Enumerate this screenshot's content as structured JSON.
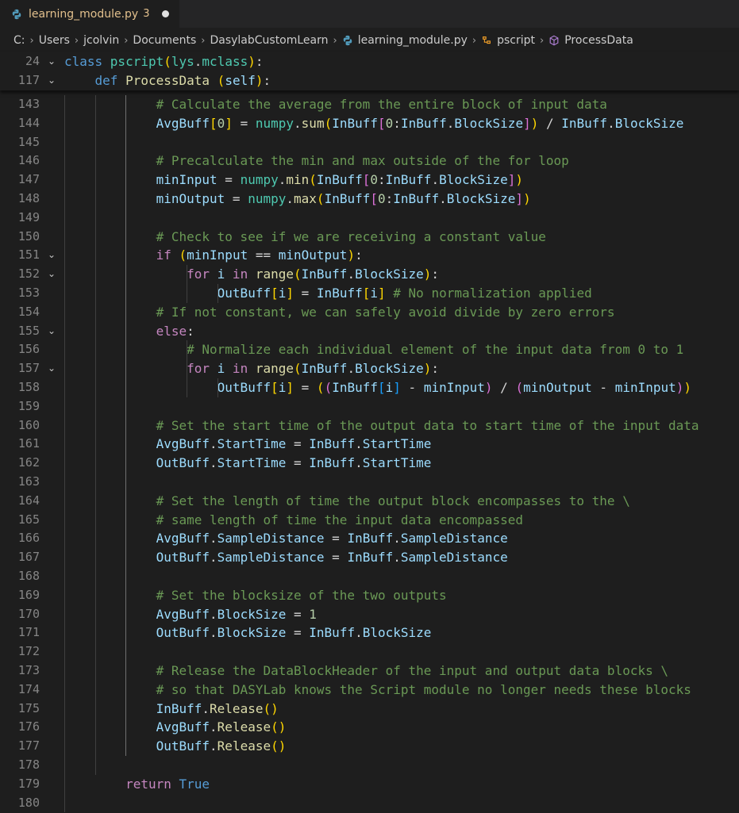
{
  "tab": {
    "filename": "learning_module.py",
    "problem_count": "3"
  },
  "breadcrumb": {
    "items": [
      "C:",
      "Users",
      "jcolvin",
      "Documents",
      "DasylabCustomLearn",
      "learning_module.py",
      "pscript",
      "ProcessData"
    ]
  },
  "sticky_scroll": [
    {
      "line": "24",
      "tokens": [
        [
          "kw",
          "class "
        ],
        [
          "cls",
          "pscript"
        ],
        [
          "b1",
          "("
        ],
        [
          "cls",
          "lys"
        ],
        [
          "op",
          "."
        ],
        [
          "cls",
          "mclass"
        ],
        [
          "b1",
          ")"
        ],
        [
          "op",
          ":"
        ]
      ]
    },
    {
      "line": "117",
      "tokens": [
        [
          "op",
          "    "
        ],
        [
          "kw",
          "def "
        ],
        [
          "fn",
          "ProcessData"
        ],
        [
          "op",
          " "
        ],
        [
          "b1",
          "("
        ],
        [
          "slf",
          "self"
        ],
        [
          "b1",
          ")"
        ],
        [
          "op",
          ":"
        ]
      ]
    }
  ],
  "code_lines": [
    {
      "line": "143",
      "tokens": [
        [
          "op",
          "            "
        ],
        [
          "cmt",
          "# Calculate the average from the entire block of input data"
        ]
      ]
    },
    {
      "line": "144",
      "tokens": [
        [
          "op",
          "            "
        ],
        [
          "var",
          "AvgBuff"
        ],
        [
          "b1",
          "["
        ],
        [
          "num",
          "0"
        ],
        [
          "b1",
          "]"
        ],
        [
          "op",
          " = "
        ],
        [
          "cls",
          "numpy"
        ],
        [
          "op",
          "."
        ],
        [
          "fn",
          "sum"
        ],
        [
          "b1",
          "("
        ],
        [
          "var",
          "InBuff"
        ],
        [
          "b2",
          "["
        ],
        [
          "num",
          "0"
        ],
        [
          "op",
          ":"
        ],
        [
          "var",
          "InBuff"
        ],
        [
          "op",
          "."
        ],
        [
          "var",
          "BlockSize"
        ],
        [
          "b2",
          "]"
        ],
        [
          "b1",
          ")"
        ],
        [
          "op",
          " / "
        ],
        [
          "var",
          "InBuff"
        ],
        [
          "op",
          "."
        ],
        [
          "var",
          "BlockSize"
        ]
      ]
    },
    {
      "line": "145",
      "tokens": []
    },
    {
      "line": "146",
      "tokens": [
        [
          "op",
          "            "
        ],
        [
          "cmt",
          "# Precalculate the min and max outside of the for loop"
        ]
      ]
    },
    {
      "line": "147",
      "tokens": [
        [
          "op",
          "            "
        ],
        [
          "var",
          "minInput"
        ],
        [
          "op",
          " = "
        ],
        [
          "cls",
          "numpy"
        ],
        [
          "op",
          "."
        ],
        [
          "fn",
          "min"
        ],
        [
          "b1",
          "("
        ],
        [
          "var",
          "InBuff"
        ],
        [
          "b2",
          "["
        ],
        [
          "num",
          "0"
        ],
        [
          "op",
          ":"
        ],
        [
          "var",
          "InBuff"
        ],
        [
          "op",
          "."
        ],
        [
          "var",
          "BlockSize"
        ],
        [
          "b2",
          "]"
        ],
        [
          "b1",
          ")"
        ]
      ]
    },
    {
      "line": "148",
      "tokens": [
        [
          "op",
          "            "
        ],
        [
          "var",
          "minOutput"
        ],
        [
          "op",
          " = "
        ],
        [
          "cls",
          "numpy"
        ],
        [
          "op",
          "."
        ],
        [
          "fn",
          "max"
        ],
        [
          "b1",
          "("
        ],
        [
          "var",
          "InBuff"
        ],
        [
          "b2",
          "["
        ],
        [
          "num",
          "0"
        ],
        [
          "op",
          ":"
        ],
        [
          "var",
          "InBuff"
        ],
        [
          "op",
          "."
        ],
        [
          "var",
          "BlockSize"
        ],
        [
          "b2",
          "]"
        ],
        [
          "b1",
          ")"
        ]
      ]
    },
    {
      "line": "149",
      "tokens": []
    },
    {
      "line": "150",
      "tokens": [
        [
          "op",
          "            "
        ],
        [
          "cmt",
          "# Check to see if we are receiving a constant value"
        ]
      ]
    },
    {
      "line": "151",
      "fold": true,
      "tokens": [
        [
          "op",
          "            "
        ],
        [
          "kwc",
          "if "
        ],
        [
          "b1",
          "("
        ],
        [
          "var",
          "minInput"
        ],
        [
          "op",
          " == "
        ],
        [
          "var",
          "minOutput"
        ],
        [
          "b1",
          ")"
        ],
        [
          "op",
          ":"
        ]
      ]
    },
    {
      "line": "152",
      "fold": true,
      "tokens": [
        [
          "op",
          "                "
        ],
        [
          "kwc",
          "for "
        ],
        [
          "var",
          "i"
        ],
        [
          "kwc",
          " in "
        ],
        [
          "fn",
          "range"
        ],
        [
          "b1",
          "("
        ],
        [
          "var",
          "InBuff"
        ],
        [
          "op",
          "."
        ],
        [
          "var",
          "BlockSize"
        ],
        [
          "b1",
          ")"
        ],
        [
          "op",
          ":"
        ]
      ]
    },
    {
      "line": "153",
      "tokens": [
        [
          "op",
          "                    "
        ],
        [
          "var",
          "OutBuff"
        ],
        [
          "b1",
          "["
        ],
        [
          "var",
          "i"
        ],
        [
          "b1",
          "]"
        ],
        [
          "op",
          " = "
        ],
        [
          "var",
          "InBuff"
        ],
        [
          "b1",
          "["
        ],
        [
          "var",
          "i"
        ],
        [
          "b1",
          "]"
        ],
        [
          "op",
          " "
        ],
        [
          "cmt",
          "# No normalization applied"
        ]
      ]
    },
    {
      "line": "154",
      "tokens": [
        [
          "op",
          "            "
        ],
        [
          "cmt",
          "# If not constant, we can safely avoid divide by zero errors"
        ]
      ]
    },
    {
      "line": "155",
      "fold": true,
      "tokens": [
        [
          "op",
          "            "
        ],
        [
          "kwc",
          "else"
        ],
        [
          "op",
          ":"
        ]
      ]
    },
    {
      "line": "156",
      "tokens": [
        [
          "op",
          "                "
        ],
        [
          "cmt",
          "# Normalize each individual element of the input data from 0 to 1"
        ]
      ]
    },
    {
      "line": "157",
      "fold": true,
      "tokens": [
        [
          "op",
          "                "
        ],
        [
          "kwc",
          "for "
        ],
        [
          "var",
          "i"
        ],
        [
          "kwc",
          " in "
        ],
        [
          "fn",
          "range"
        ],
        [
          "b1",
          "("
        ],
        [
          "var",
          "InBuff"
        ],
        [
          "op",
          "."
        ],
        [
          "var",
          "BlockSize"
        ],
        [
          "b1",
          ")"
        ],
        [
          "op",
          ":"
        ]
      ]
    },
    {
      "line": "158",
      "tokens": [
        [
          "op",
          "                    "
        ],
        [
          "var",
          "OutBuff"
        ],
        [
          "b1",
          "["
        ],
        [
          "var",
          "i"
        ],
        [
          "b1",
          "]"
        ],
        [
          "op",
          " = "
        ],
        [
          "b1",
          "("
        ],
        [
          "b2",
          "("
        ],
        [
          "var",
          "InBuff"
        ],
        [
          "b3",
          "["
        ],
        [
          "var",
          "i"
        ],
        [
          "b3",
          "]"
        ],
        [
          "op",
          " - "
        ],
        [
          "var",
          "minInput"
        ],
        [
          "b2",
          ")"
        ],
        [
          "op",
          " / "
        ],
        [
          "b2",
          "("
        ],
        [
          "var",
          "minOutput"
        ],
        [
          "op",
          " - "
        ],
        [
          "var",
          "minInput"
        ],
        [
          "b2",
          ")"
        ],
        [
          "b1",
          ")"
        ]
      ]
    },
    {
      "line": "159",
      "tokens": []
    },
    {
      "line": "160",
      "tokens": [
        [
          "op",
          "            "
        ],
        [
          "cmt",
          "# Set the start time of the output data to start time of the input data"
        ]
      ]
    },
    {
      "line": "161",
      "tokens": [
        [
          "op",
          "            "
        ],
        [
          "var",
          "AvgBuff"
        ],
        [
          "op",
          "."
        ],
        [
          "var",
          "StartTime"
        ],
        [
          "op",
          " = "
        ],
        [
          "var",
          "InBuff"
        ],
        [
          "op",
          "."
        ],
        [
          "var",
          "StartTime"
        ]
      ]
    },
    {
      "line": "162",
      "tokens": [
        [
          "op",
          "            "
        ],
        [
          "var",
          "OutBuff"
        ],
        [
          "op",
          "."
        ],
        [
          "var",
          "StartTime"
        ],
        [
          "op",
          " = "
        ],
        [
          "var",
          "InBuff"
        ],
        [
          "op",
          "."
        ],
        [
          "var",
          "StartTime"
        ]
      ]
    },
    {
      "line": "163",
      "tokens": []
    },
    {
      "line": "164",
      "tokens": [
        [
          "op",
          "            "
        ],
        [
          "cmt",
          "# Set the length of time the output block encompasses to the \\"
        ]
      ]
    },
    {
      "line": "165",
      "tokens": [
        [
          "op",
          "            "
        ],
        [
          "cmt",
          "# same length of time the input data encompassed"
        ]
      ]
    },
    {
      "line": "166",
      "tokens": [
        [
          "op",
          "            "
        ],
        [
          "var",
          "AvgBuff"
        ],
        [
          "op",
          "."
        ],
        [
          "var",
          "SampleDistance"
        ],
        [
          "op",
          " = "
        ],
        [
          "var",
          "InBuff"
        ],
        [
          "op",
          "."
        ],
        [
          "var",
          "SampleDistance"
        ]
      ]
    },
    {
      "line": "167",
      "tokens": [
        [
          "op",
          "            "
        ],
        [
          "var",
          "OutBuff"
        ],
        [
          "op",
          "."
        ],
        [
          "var",
          "SampleDistance"
        ],
        [
          "op",
          " = "
        ],
        [
          "var",
          "InBuff"
        ],
        [
          "op",
          "."
        ],
        [
          "var",
          "SampleDistance"
        ]
      ]
    },
    {
      "line": "168",
      "tokens": []
    },
    {
      "line": "169",
      "tokens": [
        [
          "op",
          "            "
        ],
        [
          "cmt",
          "# Set the blocksize of the two outputs"
        ]
      ]
    },
    {
      "line": "170",
      "tokens": [
        [
          "op",
          "            "
        ],
        [
          "var",
          "AvgBuff"
        ],
        [
          "op",
          "."
        ],
        [
          "var",
          "BlockSize"
        ],
        [
          "op",
          " = "
        ],
        [
          "num",
          "1"
        ]
      ]
    },
    {
      "line": "171",
      "tokens": [
        [
          "op",
          "            "
        ],
        [
          "var",
          "OutBuff"
        ],
        [
          "op",
          "."
        ],
        [
          "var",
          "BlockSize"
        ],
        [
          "op",
          " = "
        ],
        [
          "var",
          "InBuff"
        ],
        [
          "op",
          "."
        ],
        [
          "var",
          "BlockSize"
        ]
      ]
    },
    {
      "line": "172",
      "tokens": []
    },
    {
      "line": "173",
      "tokens": [
        [
          "op",
          "            "
        ],
        [
          "cmt",
          "# Release the DataBlockHeader of the input and output data blocks \\"
        ]
      ]
    },
    {
      "line": "174",
      "tokens": [
        [
          "op",
          "            "
        ],
        [
          "cmt",
          "# so that DASYLab knows the Script module no longer needs these blocks"
        ]
      ]
    },
    {
      "line": "175",
      "tokens": [
        [
          "op",
          "            "
        ],
        [
          "var",
          "InBuff"
        ],
        [
          "op",
          "."
        ],
        [
          "fn",
          "Release"
        ],
        [
          "b1",
          "()"
        ]
      ]
    },
    {
      "line": "176",
      "tokens": [
        [
          "op",
          "            "
        ],
        [
          "var",
          "AvgBuff"
        ],
        [
          "op",
          "."
        ],
        [
          "fn",
          "Release"
        ],
        [
          "b1",
          "()"
        ]
      ]
    },
    {
      "line": "177",
      "tokens": [
        [
          "op",
          "            "
        ],
        [
          "var",
          "OutBuff"
        ],
        [
          "op",
          "."
        ],
        [
          "fn",
          "Release"
        ],
        [
          "b1",
          "()"
        ]
      ]
    },
    {
      "line": "178",
      "tokens": []
    },
    {
      "line": "179",
      "tokens": [
        [
          "op",
          "        "
        ],
        [
          "kwc",
          "return "
        ],
        [
          "con",
          "True"
        ]
      ]
    },
    {
      "line": "180",
      "tokens": []
    }
  ]
}
